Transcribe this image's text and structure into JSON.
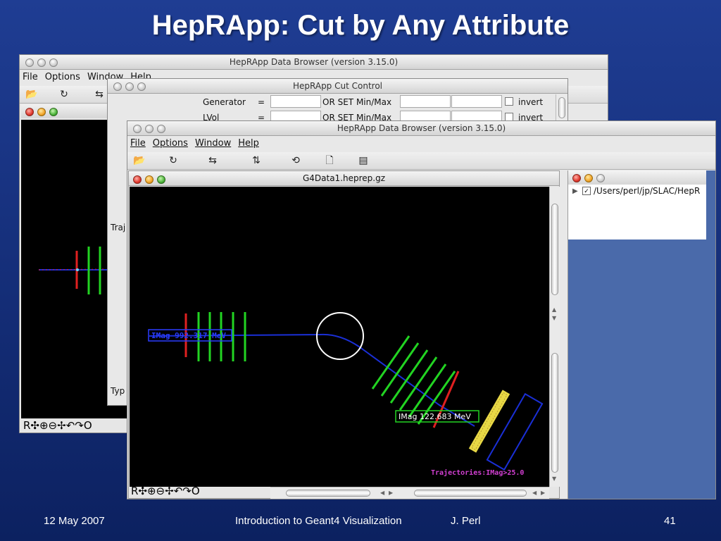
{
  "slide": {
    "title": "HepRApp: Cut by Any Attribute",
    "date": "12 May 2007",
    "course": "Introduction to Geant4 Visualization",
    "author": "J. Perl",
    "page": "41"
  },
  "back_window": {
    "title": "HepRApp Data Browser (version 3.15.0)",
    "menu": [
      "File",
      "Options",
      "Window",
      "Help"
    ],
    "status": "R✣⊕⊖✢↶↷O"
  },
  "cut_control": {
    "title": "HepRApp Cut Control",
    "rows": [
      {
        "label": "Generator",
        "eq": "=",
        "or_set": "OR SET Min/Max",
        "invert": "invert"
      },
      {
        "label": "LVol",
        "eq": "=",
        "or_set": "OR SET Min/Max",
        "invert": "invert"
      }
    ],
    "side_labels": [
      "Traj",
      "Typ"
    ]
  },
  "front_window": {
    "title": "HepRApp Data Browser (version 3.15.0)",
    "menu": [
      "File",
      "Options",
      "Window",
      "Help"
    ],
    "doc_title": "G4Data1.heprep.gz",
    "status": "R✣⊕⊖✢↶↷O",
    "labels": {
      "imag_left": "IMag 992.317 MeV",
      "imag_right": "IMag 122.683 MeV",
      "trajectories": "Trajectories:IMag>25.0"
    }
  },
  "tree_window": {
    "path": "/Users/perl/jp/SLAC/HepR"
  },
  "colors": {
    "track": "#1a2fd6",
    "detector_green": "#22d422",
    "detector_red": "#e02020",
    "calorimeter_yellow": "#e8d845",
    "magnet_outline": "#ffffff",
    "label_magenta": "#d23fd2",
    "slide_bg": "#1a3688"
  }
}
